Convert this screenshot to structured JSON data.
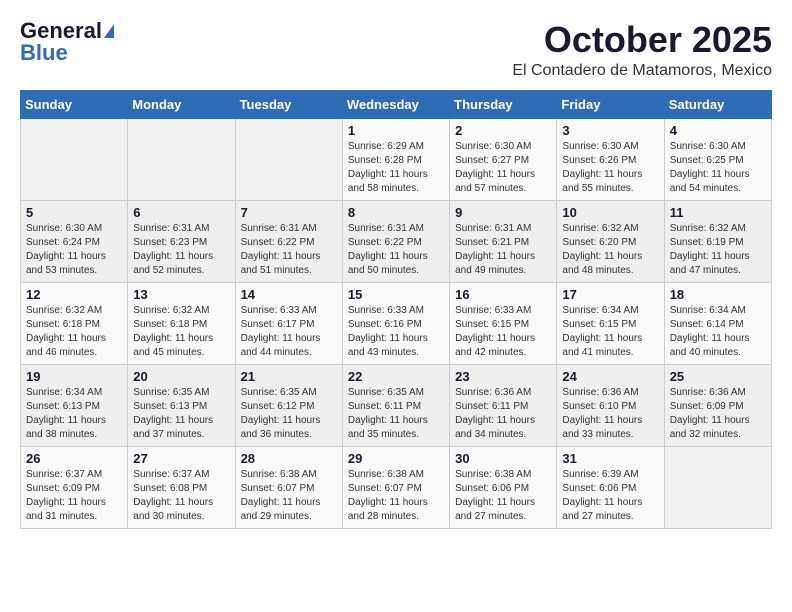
{
  "header": {
    "logo_general": "General",
    "logo_blue": "Blue",
    "month": "October 2025",
    "location": "El Contadero de Matamoros, Mexico"
  },
  "weekdays": [
    "Sunday",
    "Monday",
    "Tuesday",
    "Wednesday",
    "Thursday",
    "Friday",
    "Saturday"
  ],
  "weeks": [
    [
      {
        "day": "",
        "sunrise": "",
        "sunset": "",
        "daylight": ""
      },
      {
        "day": "",
        "sunrise": "",
        "sunset": "",
        "daylight": ""
      },
      {
        "day": "",
        "sunrise": "",
        "sunset": "",
        "daylight": ""
      },
      {
        "day": "1",
        "sunrise": "Sunrise: 6:29 AM",
        "sunset": "Sunset: 6:28 PM",
        "daylight": "Daylight: 11 hours and 58 minutes."
      },
      {
        "day": "2",
        "sunrise": "Sunrise: 6:30 AM",
        "sunset": "Sunset: 6:27 PM",
        "daylight": "Daylight: 11 hours and 57 minutes."
      },
      {
        "day": "3",
        "sunrise": "Sunrise: 6:30 AM",
        "sunset": "Sunset: 6:26 PM",
        "daylight": "Daylight: 11 hours and 55 minutes."
      },
      {
        "day": "4",
        "sunrise": "Sunrise: 6:30 AM",
        "sunset": "Sunset: 6:25 PM",
        "daylight": "Daylight: 11 hours and 54 minutes."
      }
    ],
    [
      {
        "day": "5",
        "sunrise": "Sunrise: 6:30 AM",
        "sunset": "Sunset: 6:24 PM",
        "daylight": "Daylight: 11 hours and 53 minutes."
      },
      {
        "day": "6",
        "sunrise": "Sunrise: 6:31 AM",
        "sunset": "Sunset: 6:23 PM",
        "daylight": "Daylight: 11 hours and 52 minutes."
      },
      {
        "day": "7",
        "sunrise": "Sunrise: 6:31 AM",
        "sunset": "Sunset: 6:22 PM",
        "daylight": "Daylight: 11 hours and 51 minutes."
      },
      {
        "day": "8",
        "sunrise": "Sunrise: 6:31 AM",
        "sunset": "Sunset: 6:22 PM",
        "daylight": "Daylight: 11 hours and 50 minutes."
      },
      {
        "day": "9",
        "sunrise": "Sunrise: 6:31 AM",
        "sunset": "Sunset: 6:21 PM",
        "daylight": "Daylight: 11 hours and 49 minutes."
      },
      {
        "day": "10",
        "sunrise": "Sunrise: 6:32 AM",
        "sunset": "Sunset: 6:20 PM",
        "daylight": "Daylight: 11 hours and 48 minutes."
      },
      {
        "day": "11",
        "sunrise": "Sunrise: 6:32 AM",
        "sunset": "Sunset: 6:19 PM",
        "daylight": "Daylight: 11 hours and 47 minutes."
      }
    ],
    [
      {
        "day": "12",
        "sunrise": "Sunrise: 6:32 AM",
        "sunset": "Sunset: 6:18 PM",
        "daylight": "Daylight: 11 hours and 46 minutes."
      },
      {
        "day": "13",
        "sunrise": "Sunrise: 6:32 AM",
        "sunset": "Sunset: 6:18 PM",
        "daylight": "Daylight: 11 hours and 45 minutes."
      },
      {
        "day": "14",
        "sunrise": "Sunrise: 6:33 AM",
        "sunset": "Sunset: 6:17 PM",
        "daylight": "Daylight: 11 hours and 44 minutes."
      },
      {
        "day": "15",
        "sunrise": "Sunrise: 6:33 AM",
        "sunset": "Sunset: 6:16 PM",
        "daylight": "Daylight: 11 hours and 43 minutes."
      },
      {
        "day": "16",
        "sunrise": "Sunrise: 6:33 AM",
        "sunset": "Sunset: 6:15 PM",
        "daylight": "Daylight: 11 hours and 42 minutes."
      },
      {
        "day": "17",
        "sunrise": "Sunrise: 6:34 AM",
        "sunset": "Sunset: 6:15 PM",
        "daylight": "Daylight: 11 hours and 41 minutes."
      },
      {
        "day": "18",
        "sunrise": "Sunrise: 6:34 AM",
        "sunset": "Sunset: 6:14 PM",
        "daylight": "Daylight: 11 hours and 40 minutes."
      }
    ],
    [
      {
        "day": "19",
        "sunrise": "Sunrise: 6:34 AM",
        "sunset": "Sunset: 6:13 PM",
        "daylight": "Daylight: 11 hours and 38 minutes."
      },
      {
        "day": "20",
        "sunrise": "Sunrise: 6:35 AM",
        "sunset": "Sunset: 6:13 PM",
        "daylight": "Daylight: 11 hours and 37 minutes."
      },
      {
        "day": "21",
        "sunrise": "Sunrise: 6:35 AM",
        "sunset": "Sunset: 6:12 PM",
        "daylight": "Daylight: 11 hours and 36 minutes."
      },
      {
        "day": "22",
        "sunrise": "Sunrise: 6:35 AM",
        "sunset": "Sunset: 6:11 PM",
        "daylight": "Daylight: 11 hours and 35 minutes."
      },
      {
        "day": "23",
        "sunrise": "Sunrise: 6:36 AM",
        "sunset": "Sunset: 6:11 PM",
        "daylight": "Daylight: 11 hours and 34 minutes."
      },
      {
        "day": "24",
        "sunrise": "Sunrise: 6:36 AM",
        "sunset": "Sunset: 6:10 PM",
        "daylight": "Daylight: 11 hours and 33 minutes."
      },
      {
        "day": "25",
        "sunrise": "Sunrise: 6:36 AM",
        "sunset": "Sunset: 6:09 PM",
        "daylight": "Daylight: 11 hours and 32 minutes."
      }
    ],
    [
      {
        "day": "26",
        "sunrise": "Sunrise: 6:37 AM",
        "sunset": "Sunset: 6:09 PM",
        "daylight": "Daylight: 11 hours and 31 minutes."
      },
      {
        "day": "27",
        "sunrise": "Sunrise: 6:37 AM",
        "sunset": "Sunset: 6:08 PM",
        "daylight": "Daylight: 11 hours and 30 minutes."
      },
      {
        "day": "28",
        "sunrise": "Sunrise: 6:38 AM",
        "sunset": "Sunset: 6:07 PM",
        "daylight": "Daylight: 11 hours and 29 minutes."
      },
      {
        "day": "29",
        "sunrise": "Sunrise: 6:38 AM",
        "sunset": "Sunset: 6:07 PM",
        "daylight": "Daylight: 11 hours and 28 minutes."
      },
      {
        "day": "30",
        "sunrise": "Sunrise: 6:38 AM",
        "sunset": "Sunset: 6:06 PM",
        "daylight": "Daylight: 11 hours and 27 minutes."
      },
      {
        "day": "31",
        "sunrise": "Sunrise: 6:39 AM",
        "sunset": "Sunset: 6:06 PM",
        "daylight": "Daylight: 11 hours and 27 minutes."
      },
      {
        "day": "",
        "sunrise": "",
        "sunset": "",
        "daylight": ""
      }
    ]
  ]
}
